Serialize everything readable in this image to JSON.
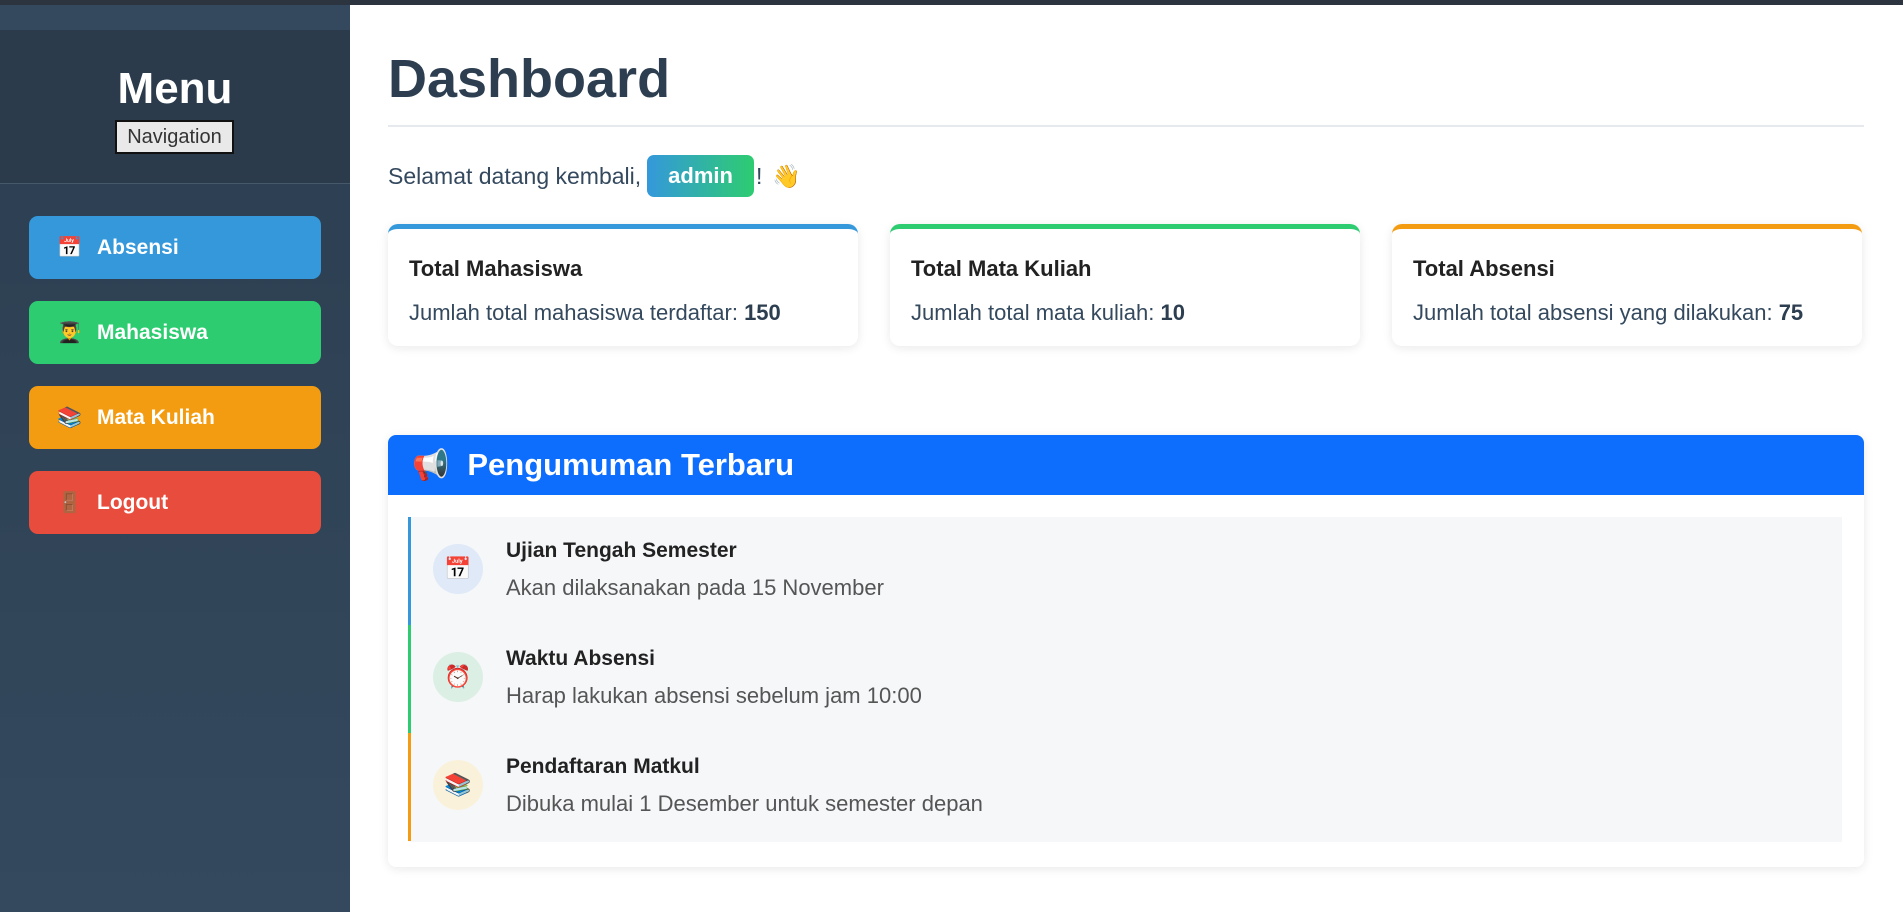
{
  "sidebar": {
    "title": "Menu",
    "subtitle": "Navigation",
    "items": [
      {
        "label": "Absensi",
        "icon": "📅",
        "color": "#3498db"
      },
      {
        "label": "Mahasiswa",
        "icon": "👨‍🎓",
        "color": "#2ecc71"
      },
      {
        "label": "Mata Kuliah",
        "icon": "📚",
        "color": "#f39c12"
      },
      {
        "label": "Logout",
        "icon": "🚪",
        "color": "#e74c3c"
      }
    ]
  },
  "main": {
    "title": "Dashboard",
    "welcome_prefix": "Selamat datang kembali,",
    "username": "admin",
    "welcome_suffix": "!",
    "wave_icon": "👋",
    "stats": [
      {
        "title": "Total Mahasiswa",
        "desc": "Jumlah total mahasiswa terdaftar:",
        "value": "150",
        "color": "#3498db"
      },
      {
        "title": "Total Mata Kuliah",
        "desc": "Jumlah total mata kuliah:",
        "value": "10",
        "color": "#2ecc71"
      },
      {
        "title": "Total Absensi",
        "desc": "Jumlah total absensi yang dilakukan:",
        "value": "75",
        "color": "#f39c12"
      }
    ],
    "announcements": {
      "header_icon": "📢",
      "title": "Pengumuman Terbaru",
      "items": [
        {
          "icon": "📅",
          "title": "Ujian Tengah Semester",
          "text": "Akan dilaksanakan pada 15 November"
        },
        {
          "icon": "⏰",
          "title": "Waktu Absensi",
          "text": "Harap lakukan absensi sebelum jam 10:00"
        },
        {
          "icon": "📚",
          "title": "Pendaftaran Matkul",
          "text": "Dibuka mulai 1 Desember untuk semester depan"
        }
      ]
    }
  }
}
